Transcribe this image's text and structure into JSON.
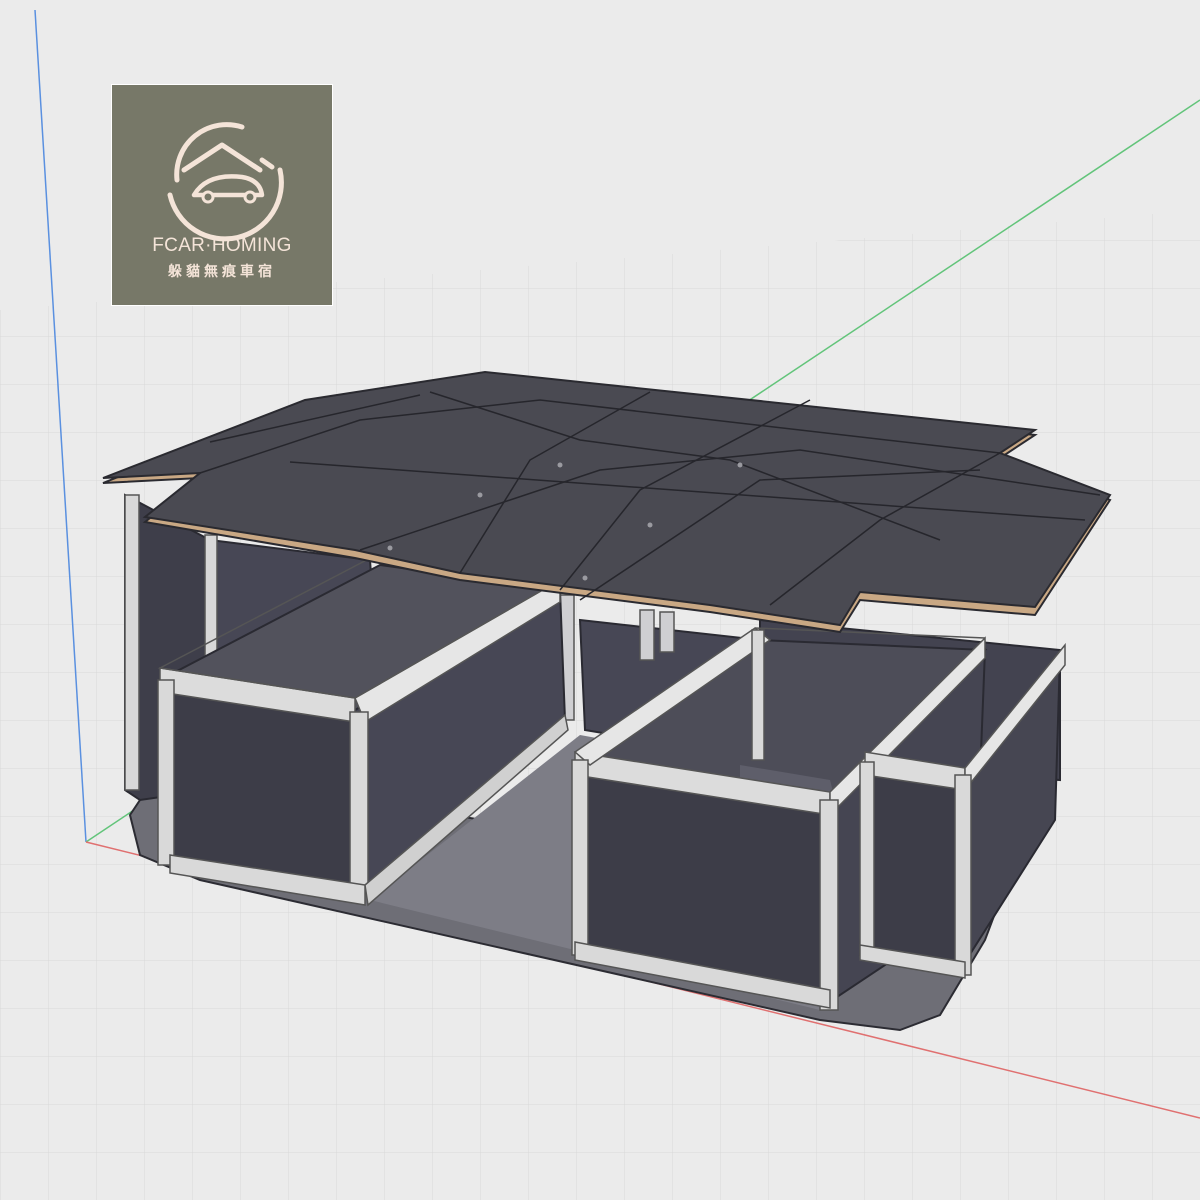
{
  "viewport": {
    "name": "3D model view",
    "colors": {
      "background": "#ebebeb",
      "grid": "#d4d4d4",
      "axis_x": "#e07070",
      "axis_y": "#62c47a",
      "axis_z": "#5a90e0",
      "panel_dark": "#3d3d48",
      "panel_top": "#4a4a52",
      "frame": "#dcdcdc",
      "floor": "#6b6b73",
      "plywood_edge": "#c9a884"
    }
  },
  "logo": {
    "name_en": "FCAR·HOMING",
    "name_zh": "躲貓無痕車宿",
    "background": "#777868",
    "foreground": "#f4e4d8"
  }
}
